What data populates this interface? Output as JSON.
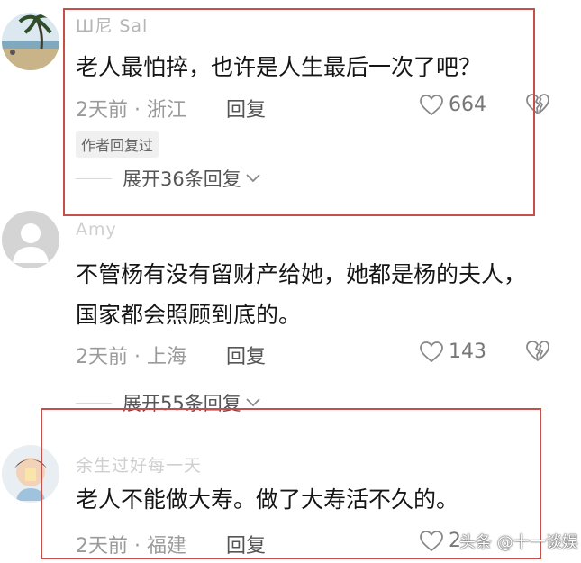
{
  "comments": [
    {
      "username": "Ш尼 Sal",
      "text": "老人最怕捽，也许是人生最后一次了吧？",
      "meta": "2天前 · 浙江",
      "reply_label": "回复",
      "likes": "664",
      "badge": "作者回复过",
      "expand_label": "展开36条回复"
    },
    {
      "username": "Amy",
      "text": "不管杨有没有留财产给她，她都是杨的夫人，国家都会照顾到底的。",
      "meta": "2天前 · 上海",
      "reply_label": "回复",
      "likes": "143",
      "expand_label": "展开55条回复"
    },
    {
      "username": "余生过好每一天",
      "text": "老人不能做大寿。做了大寿活不久的。",
      "meta": "2天前 · 福建",
      "reply_label": "回复",
      "likes": "2"
    }
  ],
  "watermark": "头条 @十一谈娱",
  "colors": {
    "highlight_box": "#c4504c",
    "meta": "#9a9a9a"
  }
}
